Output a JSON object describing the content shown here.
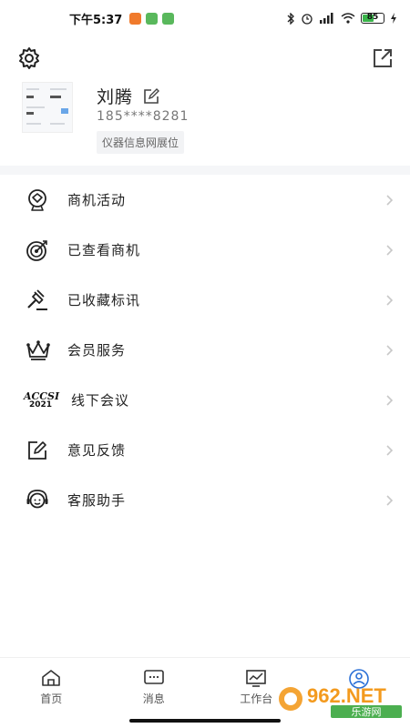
{
  "status_bar": {
    "time": "下午5:37",
    "battery_percent": "85",
    "icons": [
      "bluetooth-icon",
      "alarm-icon",
      "signal-icon",
      "wifi-icon",
      "battery-icon",
      "charging-icon"
    ]
  },
  "header": {
    "settings_icon": "gear-icon",
    "share_icon": "share-external-icon"
  },
  "profile": {
    "name": "刘腾",
    "phone": "185****8281",
    "tag": "仪器信息网展位"
  },
  "menu": {
    "items": [
      {
        "label": "商机活动",
        "icon": "activity-badge-icon"
      },
      {
        "label": "已查看商机",
        "icon": "target-icon"
      },
      {
        "label": "已收藏标讯",
        "icon": "gavel-icon"
      },
      {
        "label": "会员服务",
        "icon": "crown-icon"
      },
      {
        "label": "线下会议",
        "icon": "accsi-2021-logo-icon"
      },
      {
        "label": "意见反馈",
        "icon": "edit-feedback-icon"
      },
      {
        "label": "客服助手",
        "icon": "headset-service-icon"
      }
    ]
  },
  "logo_text": {
    "accsi": "ACCSI",
    "year": "2021"
  },
  "bottom_nav": {
    "tabs": [
      {
        "label": "首页",
        "icon": "home-icon"
      },
      {
        "label": "消息",
        "icon": "message-icon"
      },
      {
        "label": "工作台",
        "icon": "workbench-chart-icon"
      },
      {
        "label": "",
        "icon": "profile-user-icon"
      }
    ]
  },
  "watermark": {
    "brand": "962.NET",
    "sub": "乐游网"
  },
  "colors": {
    "divider_band": "#f5f6f8",
    "text_primary": "#222222",
    "text_secondary": "#777777",
    "watermark_orange": "#f39a1e",
    "watermark_green": "#4caf50"
  }
}
